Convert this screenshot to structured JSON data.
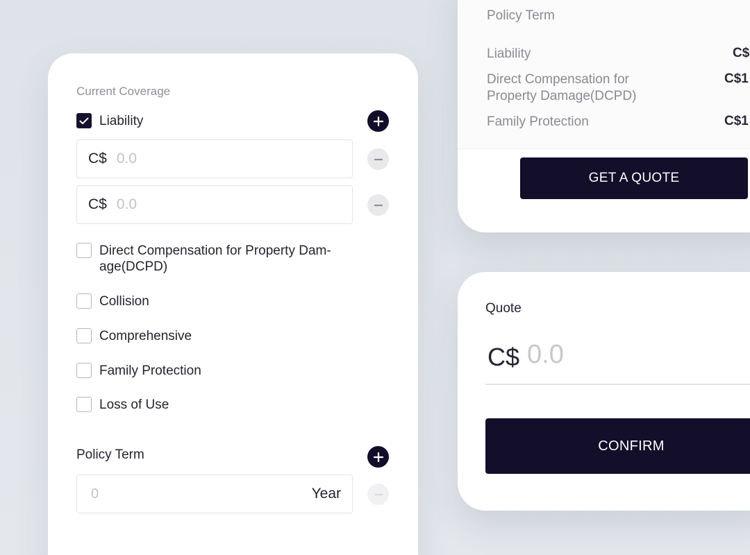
{
  "coverage_form": {
    "section_title": "Current Coverage",
    "coverages": [
      {
        "label": "Liability",
        "checked": true
      },
      {
        "label": "Direct Compensation for Property Dam-age(DCPD)",
        "checked": false
      },
      {
        "label": "Collision",
        "checked": false
      },
      {
        "label": "Comprehensive",
        "checked": false
      },
      {
        "label": "Family Protection",
        "checked": false
      },
      {
        "label": "Loss of Use",
        "checked": false
      }
    ],
    "liability_amounts": [
      {
        "currency": "C$",
        "placeholder": "0.0"
      },
      {
        "currency": "C$",
        "placeholder": "0.0"
      }
    ],
    "policy_term": {
      "label": "Policy Term",
      "placeholder": "0",
      "unit": "Year"
    }
  },
  "summary_card": {
    "title": "Policy Term",
    "rows": [
      {
        "label": "Liability",
        "value": "C$"
      },
      {
        "label": "Direct Compensation for Property Damage(DCPD)",
        "value": "C$1"
      },
      {
        "label": "Family Protection",
        "value": "C$1"
      }
    ],
    "button_label": "GET A QUOTE"
  },
  "quote_card": {
    "title": "Quote",
    "currency": "C$",
    "placeholder": "0.0",
    "button_label": "CONFIRM"
  },
  "colors": {
    "primary_dark": "#130e2a",
    "background": "#e1e4ea",
    "card": "#ffffff",
    "muted_text": "#8a8a93"
  }
}
